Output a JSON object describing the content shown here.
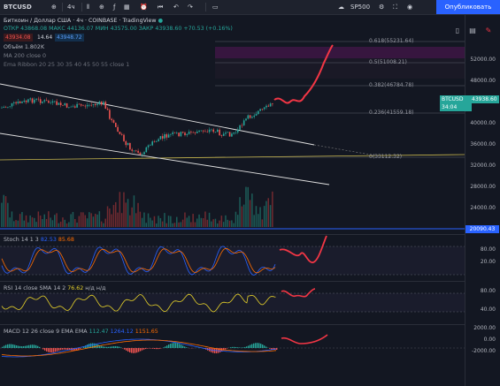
{
  "toolbar": {
    "symbol": "BTCUSD",
    "interval": "4ч",
    "indicator_icon": "crosshair-plus-icon",
    "search_value": "SP500",
    "publish_label": "Опубликовать"
  },
  "legend": {
    "title": "Биткоин / Доллар США",
    "interval": "4ч",
    "exchange": "COINBASE",
    "source": "TradingView",
    "ohlc": "ОТКР 43868.08  МАКС 44136.07  МИН 43575.00  ЗАКР 43938.60  +70.53 (+0.16%)",
    "bid": "43934.08",
    "spread": "14.64",
    "ask": "43948.72",
    "volume": "Объём  1.802K",
    "ma": "MA 200 close 0",
    "ribbon": "Ema Ribbon 20 25 30 35 40 45 50 55 close 1"
  },
  "fib_levels": [
    {
      "label": "0.618(55231.64)"
    },
    {
      "label": "0.5(51008.21)"
    },
    {
      "label": "0.382(46784.78)"
    },
    {
      "label": "0.236(41559.18)"
    },
    {
      "label": "0(33112.32)"
    }
  ],
  "price_axis": [
    "52000.00",
    "48000.00",
    "44000.00",
    "40000.00",
    "36000.00",
    "32000.00",
    "28000.00",
    "24000.00"
  ],
  "current_price": {
    "symbol": "BTCUSD",
    "price": "43938.60",
    "countdown": "34:04"
  },
  "level_marker": "20090.43",
  "stoch": {
    "legend": "Stoch  14  1  3",
    "k": "82.53",
    "d": "85.68",
    "ticks": [
      "80.00",
      "20.00"
    ]
  },
  "rsi": {
    "legend": "RSI  14  close  SMA  14  2",
    "value": "76.62",
    "na": "н/д  н/д",
    "ticks": [
      "80.00",
      "40.00"
    ]
  },
  "macd": {
    "legend": "MACD  12  26  close  9  EMA  EMA",
    "hist": "112.47",
    "macd": "1264.12",
    "signal": "1151.65",
    "ticks": [
      "2000.00",
      "0.00",
      "-2000.00"
    ]
  },
  "colors": {
    "up": "#26a69a",
    "down": "#ef5350",
    "accent": "#2962ff",
    "fib_zone": "#4a1a4f",
    "forecast": "#f23645"
  }
}
